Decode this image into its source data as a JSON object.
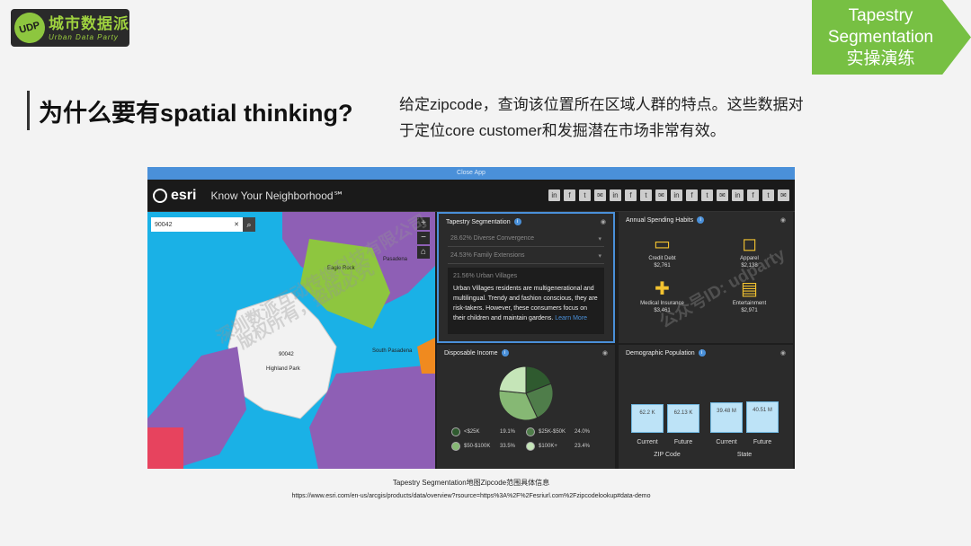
{
  "logo": {
    "mark": "UDP",
    "cn": "城市数据派",
    "en": "Urban Data Party"
  },
  "tag": {
    "line1": "Tapestry",
    "line2": "Segmentation",
    "line3": "实操演练"
  },
  "heading": "为什么要有spatial thinking?",
  "description": "给定zipcode，查询该位置所在区域人群的特点。这些数据对于定位core customer和发掘潜在市场非常有效。",
  "app": {
    "close": "Close App",
    "brand": "esri",
    "title": "Know Your Neighborhood℠",
    "share_icons": [
      "in",
      "f",
      "t",
      "✉",
      "in",
      "f",
      "t",
      "✉",
      "in",
      "f",
      "t",
      "✉",
      "in",
      "f",
      "t",
      "✉"
    ],
    "search": {
      "value": "90042",
      "clear": "✕",
      "search_icon": "search-icon"
    },
    "map_labels": {
      "zip": "90042",
      "place1": "Highland Park",
      "place2": "Eagle Rock",
      "place3": "Pasadena",
      "place4": "South Pasadena"
    },
    "tapestry": {
      "title": "Tapestry Segmentation",
      "items": [
        "28.62% Diverse Convergence",
        "24.53% Family Extensions"
      ],
      "expanded_title": "21.56% Urban Villages",
      "expanded_text": "Urban Villages residents are multigenerational and multilingual. Trendy and fashion conscious, they are risk-takers. However, these consumers focus on their children and maintain gardens.",
      "learn_more": "Learn More"
    },
    "spending": {
      "title": "Annual Spending Habits",
      "items": [
        {
          "label": "Credit Debt",
          "value": "$2,761",
          "icon": "credit-card-icon"
        },
        {
          "label": "Apparel",
          "value": "$2,138",
          "icon": "shopping-bag-icon"
        },
        {
          "label": "Medical Insurance",
          "value": "$3,461",
          "icon": "medical-icon"
        },
        {
          "label": "Entertainment",
          "value": "$2,971",
          "icon": "film-icon"
        }
      ]
    },
    "income": {
      "title": "Disposable Income",
      "slices": [
        {
          "label": "<$25K",
          "pct": "19.1%",
          "color": "#2f5a2f"
        },
        {
          "label": "$25K-$50K",
          "pct": "24.0%",
          "color": "#4f7d4a"
        },
        {
          "label": "$50-$100K",
          "pct": "33.5%",
          "color": "#86b874"
        },
        {
          "label": "$100K+",
          "pct": "23.4%",
          "color": "#c5e5b8"
        }
      ]
    },
    "demographic": {
      "title": "Demographic Population",
      "bars": [
        {
          "value": "62.2 K",
          "label": "Current"
        },
        {
          "value": "62.13 K",
          "label": "Future"
        },
        {
          "value": "39.48 M",
          "label": "Current"
        },
        {
          "value": "40.51 M",
          "label": "Future"
        }
      ],
      "groups": [
        "ZIP Code",
        "State"
      ]
    }
  },
  "watermark": {
    "line1": "深圳数派互动传媒科技有限公司",
    "line2": "版权所有，盗版必究",
    "line3": "公众号ID: udparty"
  },
  "caption": {
    "title": "Tapestry Segmentation地图Zipcode范围具体信息",
    "url": "https://www.esri.com/en-us/arcgis/products/data/overview?rsource=https%3A%2F%2Fesriurl.com%2Fzipcodelookup#data-demo"
  }
}
